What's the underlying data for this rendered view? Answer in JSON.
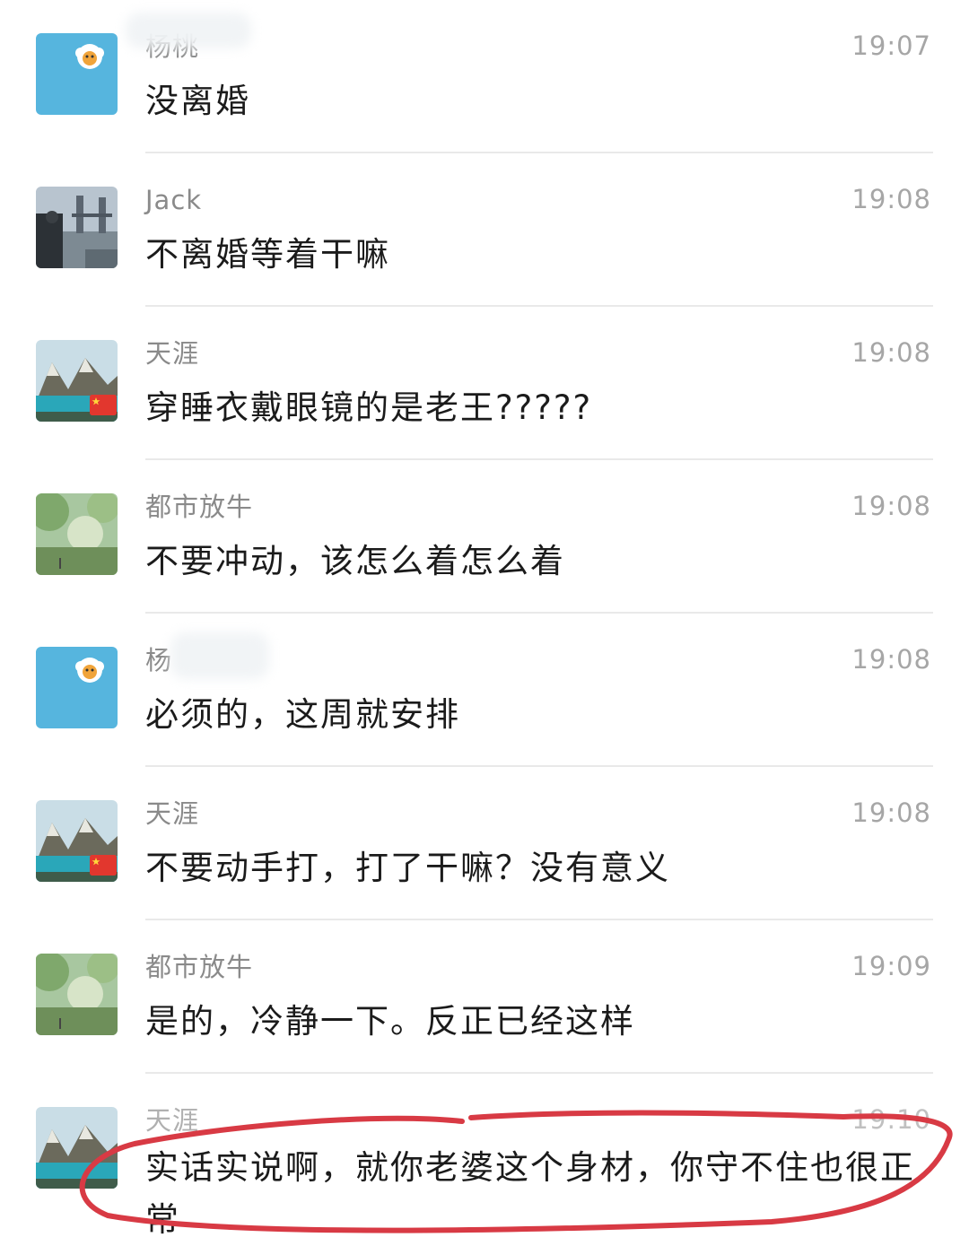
{
  "messages": [
    {
      "name": "杨桃",
      "time": "19:07",
      "text": "没离婚",
      "avatar": "sheep-avatar"
    },
    {
      "name": "Jack",
      "time": "19:08",
      "text": "不离婚等着干嘛",
      "avatar": "bridge-photo-avatar"
    },
    {
      "name": "天涯",
      "time": "19:08",
      "text": "穿睡衣戴眼镜的是老王?????",
      "avatar": "mountain-lake-avatar"
    },
    {
      "name": "都市放牛",
      "time": "19:08",
      "text": "不要冲动，该怎么着怎么着",
      "avatar": "green-forest-avatar"
    },
    {
      "name": "杨",
      "time": "19:08",
      "text": "必须的，这周就安排",
      "avatar": "sheep-avatar"
    },
    {
      "name": "天涯",
      "time": "19:08",
      "text": "不要动手打，打了干嘛？没有意义",
      "avatar": "mountain-lake-avatar"
    },
    {
      "name": "都市放牛",
      "time": "19:09",
      "text": "是的，冷静一下。反正已经这样",
      "avatar": "green-forest-avatar"
    },
    {
      "name": "天涯",
      "time": "19:10",
      "text": "实话实说啊，就你老婆这个身材，你守不住也很正常",
      "avatar": "mountain-lake-avatar"
    }
  ],
  "colors": {
    "sheep_bg": "#56b5de",
    "highlight_circle": "#d83a44",
    "divider": "#e9e9e9"
  }
}
